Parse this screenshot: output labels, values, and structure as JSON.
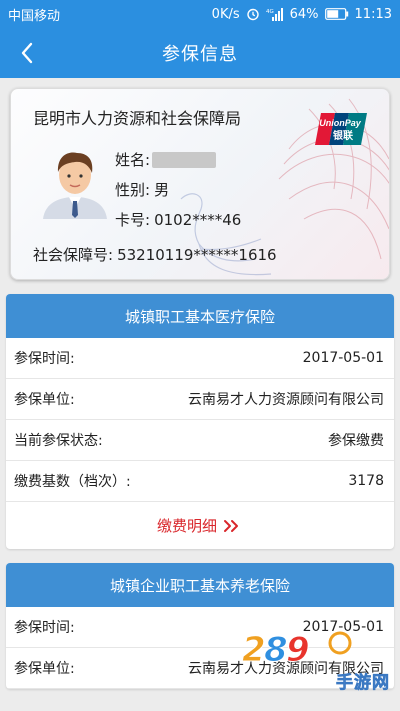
{
  "status_bar": {
    "carrier": "中国移动",
    "speed": "0K/s",
    "network": "4G",
    "battery": "64%",
    "time": "11:13"
  },
  "nav": {
    "title": "参保信息",
    "back_icon": "chevron-left-icon"
  },
  "card": {
    "org": "昆明市人力资源和社会保障局",
    "name_label": "姓名:",
    "gender_label": "性别:",
    "gender_value": "男",
    "card_no_label": "卡号:",
    "card_no_value": "0102****46",
    "ssn_label": "社会保障号:",
    "ssn_value": "53210119******1616",
    "unionpay_en": "UnionPay",
    "unionpay_cn": "银联"
  },
  "panels": [
    {
      "title": "城镇职工基本医疗保险",
      "rows": [
        {
          "label": "参保时间:",
          "value": "2017-05-01"
        },
        {
          "label": "参保单位:",
          "value": "云南易才人力资源顾问有限公司"
        },
        {
          "label": "当前参保状态:",
          "value": "参保缴费"
        },
        {
          "label": "缴费基数（档次）:",
          "value": "3178"
        }
      ],
      "detail_link": "缴费明细"
    },
    {
      "title": "城镇企业职工基本养老保险",
      "rows": [
        {
          "label": "参保时间:",
          "value": "2017-05-01"
        },
        {
          "label": "参保单位:",
          "value": "云南易才人力资源顾问有限公司"
        }
      ]
    }
  ],
  "watermark": {
    "text": "手游网"
  },
  "colors": {
    "primary": "#2b8fe0",
    "panel_header": "#3f8fd4",
    "link_red": "#d9262b"
  }
}
